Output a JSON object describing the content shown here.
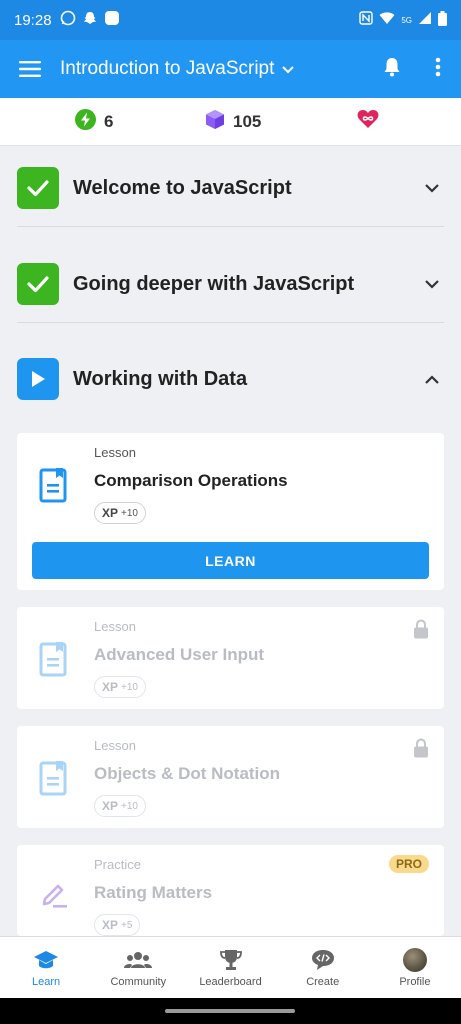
{
  "status_bar": {
    "time": "19:28",
    "network": "5G",
    "icons": [
      "whatsapp-icon",
      "snapchat-icon",
      "app-icon",
      "nfc-icon",
      "wifi-icon",
      "signal-icon",
      "battery-icon"
    ]
  },
  "app_bar": {
    "title": "Introduction to JavaScript",
    "icons": [
      "menu-icon",
      "chevron-down-icon",
      "bell-icon",
      "more-vert-icon"
    ]
  },
  "stats": {
    "streak": "6",
    "xp": "105",
    "hearts_icon": "infinity-heart-icon"
  },
  "modules": [
    {
      "title": "Welcome to JavaScript",
      "status": "completed"
    },
    {
      "title": "Going deeper with JavaScript",
      "status": "completed"
    },
    {
      "title": "Working with Data",
      "status": "in-progress"
    }
  ],
  "lessons": [
    {
      "kind": "Lesson",
      "name": "Comparison Operations",
      "xp_label": "XP",
      "xp_value": "+10",
      "button": "LEARN"
    },
    {
      "kind": "Lesson",
      "name": "Advanced User Input",
      "xp_label": "XP",
      "xp_value": "+10"
    },
    {
      "kind": "Lesson",
      "name": "Objects & Dot Notation",
      "xp_label": "XP",
      "xp_value": "+10"
    },
    {
      "kind": "Practice",
      "name": "Rating Matters",
      "xp_label": "XP",
      "xp_value": "+5",
      "badge": "PRO"
    }
  ],
  "bottom_nav": [
    {
      "label": "Learn",
      "icon": "graduation-cap-icon",
      "active": true
    },
    {
      "label": "Community",
      "icon": "people-icon"
    },
    {
      "label": "Leaderboard",
      "icon": "trophy-icon"
    },
    {
      "label": "Create",
      "icon": "code-bubble-icon"
    },
    {
      "label": "Profile",
      "icon": "avatar"
    }
  ],
  "colors": {
    "primary": "#2196f3",
    "status_bar": "#1e88e5",
    "completed": "#3cb521",
    "in_progress": "#1e96f0",
    "streak": "#3cb521",
    "xp_gem": "#8b5cf6",
    "heart": "#e0245e",
    "pro_badge": "#fbd98a"
  }
}
